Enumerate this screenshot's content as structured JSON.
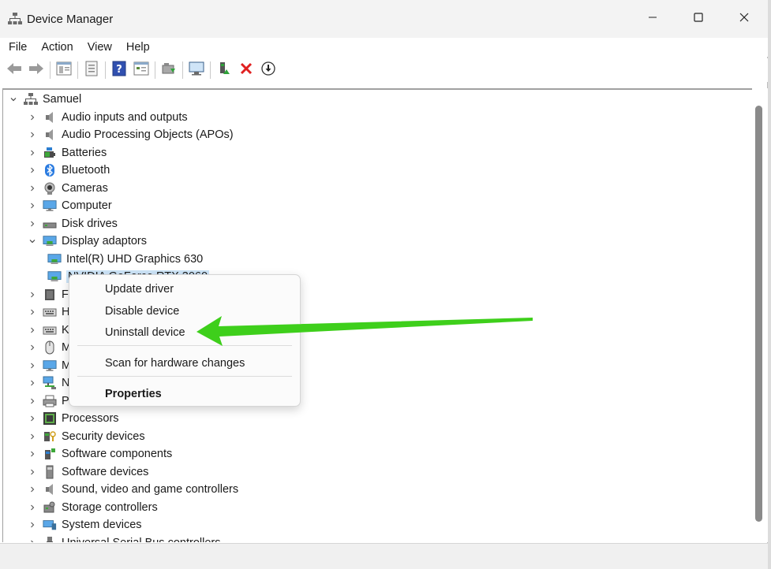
{
  "window": {
    "title": "Device Manager"
  },
  "menu": {
    "items": [
      "File",
      "Action",
      "View",
      "Help"
    ]
  },
  "toolbar": {
    "buttons": [
      "back-icon",
      "forward-icon",
      "show-hide-tree-icon",
      "properties-icon",
      "help-icon",
      "view-icon",
      "update-driver-icon",
      "scan-hardware-icon",
      "enable-device-icon",
      "uninstall-icon",
      "disable-device-icon"
    ]
  },
  "tree": {
    "root": "Samuel",
    "items": [
      {
        "label": "Audio inputs and outputs",
        "icon": "speaker-icon"
      },
      {
        "label": "Audio Processing Objects (APOs)",
        "icon": "speaker-icon"
      },
      {
        "label": "Batteries",
        "icon": "battery-icon"
      },
      {
        "label": "Bluetooth",
        "icon": "bluetooth-icon"
      },
      {
        "label": "Cameras",
        "icon": "camera-icon"
      },
      {
        "label": "Computer",
        "icon": "monitor-icon"
      },
      {
        "label": "Disk drives",
        "icon": "disk-icon"
      },
      {
        "label": "Display adaptors",
        "icon": "display-adapter-icon",
        "expanded": true
      },
      {
        "label": "Intel(R) UHD Graphics 630",
        "icon": "display-adapter-icon",
        "child": true
      },
      {
        "label": "NVIDIA GeForce RTX 3060",
        "icon": "display-adapter-icon",
        "child": true,
        "selected": true
      },
      {
        "label": "F",
        "icon": "chip-icon"
      },
      {
        "label": "H",
        "icon": "keyboard-icon"
      },
      {
        "label": "K",
        "icon": "keyboard-icon"
      },
      {
        "label": "M",
        "icon": "mouse-icon"
      },
      {
        "label": "M",
        "icon": "monitor-icon"
      },
      {
        "label": "N",
        "icon": "network-icon"
      },
      {
        "label": "P",
        "icon": "printer-icon"
      },
      {
        "label": "Processors",
        "icon": "processor-icon"
      },
      {
        "label": "Security devices",
        "icon": "security-icon"
      },
      {
        "label": "Software components",
        "icon": "component-icon"
      },
      {
        "label": "Software devices",
        "icon": "software-device-icon"
      },
      {
        "label": "Sound, video and game controllers",
        "icon": "speaker-icon"
      },
      {
        "label": "Storage controllers",
        "icon": "storage-icon"
      },
      {
        "label": "System devices",
        "icon": "system-icon"
      },
      {
        "label": "Universal Serial Bus controllers",
        "icon": "usb-icon"
      }
    ]
  },
  "context_menu": {
    "update_driver": "Update driver",
    "disable_device": "Disable device",
    "uninstall_device": "Uninstall device",
    "scan_hardware": "Scan for hardware changes",
    "properties": "Properties"
  },
  "colors": {
    "selection": "#cce4f7",
    "arrow": "#3ecf1b",
    "titlebar": "#f3f3f3"
  }
}
